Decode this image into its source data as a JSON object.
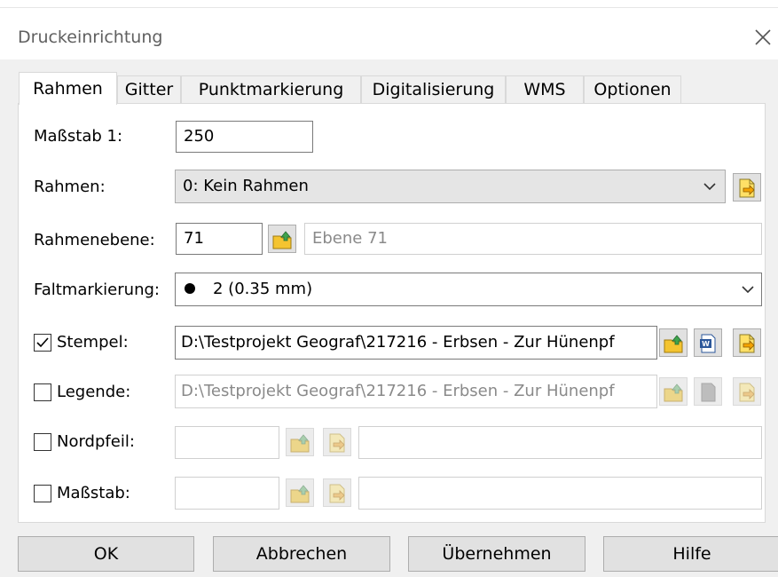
{
  "window": {
    "title": "Druckeinrichtung",
    "close_icon": "close-icon"
  },
  "tabs": [
    {
      "label": "Rahmen",
      "active": true
    },
    {
      "label": "Gitter"
    },
    {
      "label": "Punktmarkierung"
    },
    {
      "label": "Digitalisierung"
    },
    {
      "label": "WMS"
    },
    {
      "label": "Optionen"
    }
  ],
  "form": {
    "massstab": {
      "label": "Maßstab 1:",
      "value": "250"
    },
    "rahmen": {
      "label": "Rahmen:",
      "value": "0: Kein Rahmen"
    },
    "rahmenebene": {
      "label": "Rahmenebene:",
      "value": "71",
      "name": "Ebene 71"
    },
    "faltmarkierung": {
      "label": "Faltmarkierung:",
      "value": "2 (0.35 mm)"
    },
    "stempel": {
      "label": "Stempel:",
      "checked": true,
      "path": "D:\\Testprojekt Geograf\\217216 - Erbsen - Zur Hünenpf"
    },
    "legende": {
      "label": "Legende:",
      "checked": false,
      "path": "D:\\Testprojekt Geograf\\217216 - Erbsen - Zur Hünenpf"
    },
    "nordpfeil": {
      "label": "Nordpfeil:",
      "checked": false,
      "value": "",
      "name": ""
    },
    "massstab_bar": {
      "label": "Maßstab:",
      "checked": false,
      "value": "",
      "name": ""
    }
  },
  "buttons": {
    "ok": "OK",
    "cancel": "Abbrechen",
    "apply": "Übernehmen",
    "help": "Hilfe"
  },
  "colors": {
    "folder": "#f4c430",
    "folder_arrow": "#3fa34d",
    "page": "#ffe066",
    "word_blue": "#2b579a"
  }
}
